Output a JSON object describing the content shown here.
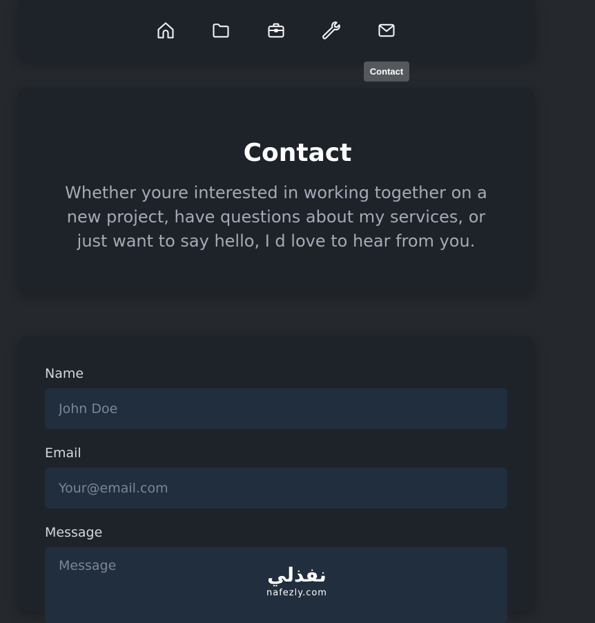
{
  "nav": {
    "items": [
      {
        "icon": "home-icon",
        "label": "Home"
      },
      {
        "icon": "folder-icon",
        "label": "Projects"
      },
      {
        "icon": "briefcase-icon",
        "label": "Experience"
      },
      {
        "icon": "wrench-icon",
        "label": "Tools"
      },
      {
        "icon": "mail-icon",
        "label": "Contact"
      }
    ],
    "tooltip": "Contact"
  },
  "hero": {
    "title": "Contact",
    "description": "Whether youre interested in working together on a new project, have questions about my services, or just want to say hello, I d love to hear from you."
  },
  "form": {
    "name_label": "Name",
    "name_placeholder": "John Doe",
    "email_label": "Email",
    "email_placeholder": "Your@email.com",
    "message_label": "Message",
    "message_placeholder": "Message"
  },
  "watermark": {
    "arabic": "نفذلي",
    "latin": "nafezly.com"
  },
  "colors": {
    "background": "#25282d",
    "card": "#1e2229",
    "input": "#212e3d",
    "tooltip": "#55585d"
  }
}
